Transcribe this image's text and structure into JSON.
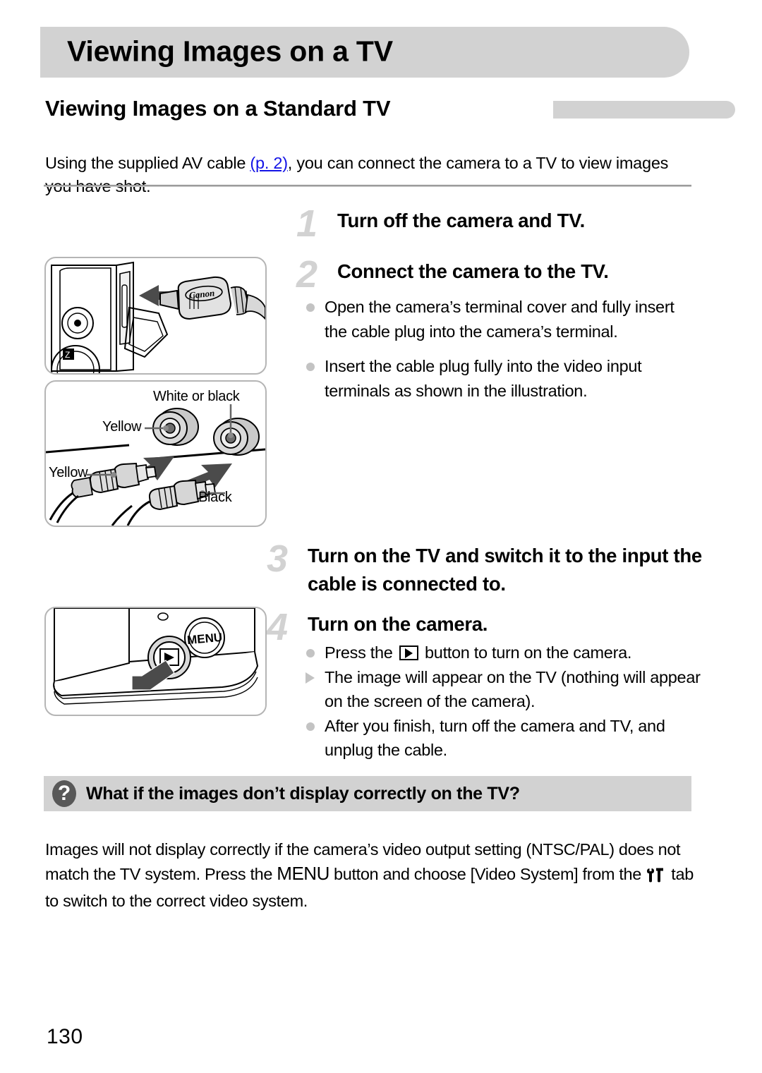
{
  "chapter": {
    "title": "Viewing Images on a TV"
  },
  "section": {
    "title": "Viewing Images on a Standard TV"
  },
  "intro": {
    "before_link": "Using the supplied AV cable ",
    "link": "(p. 2)",
    "after_link": ", you can connect the camera to a TV to view images you have shot."
  },
  "steps": [
    {
      "number": "1",
      "title": "Turn off the camera and TV."
    },
    {
      "number": "2",
      "title": "Connect the camera to the TV.",
      "bullets": [
        {
          "marker": "dot",
          "text": "Open the camera’s terminal cover and fully insert the cable plug into the camera’s terminal."
        },
        {
          "marker": "dot",
          "text": "Insert the cable plug fully into the video input terminals as shown in the illustration."
        }
      ]
    },
    {
      "number": "3",
      "title": "Turn on the TV and switch it to the input the cable is connected to."
    },
    {
      "number": "4",
      "title": "Turn on the camera.",
      "bullets": [
        {
          "marker": "dot",
          "text_before_icon": "Press the ",
          "icon": "playback-button-icon",
          "text_after_icon": " button to turn on the camera."
        },
        {
          "marker": "triangle",
          "text": "The image will appear on the TV (nothing will appear on the screen of the camera)."
        },
        {
          "marker": "dot",
          "text": "After you finish, turn off the camera and TV, and unplug the cable."
        }
      ]
    }
  ],
  "illustrations": {
    "camera_terminal": {
      "name": "camera-terminal-cable-insert",
      "brand_text": "Canon"
    },
    "av_plugs": {
      "name": "av-cable-plug-connection",
      "labels": {
        "white_or_black": "White or black",
        "yellow_jack": "Yellow",
        "yellow_plug": "Yellow",
        "black_plug": "Black"
      }
    },
    "playback_button": {
      "name": "camera-playback-button-press",
      "menu_text": "MENU"
    }
  },
  "faq": {
    "question": "What if the images don’t display correctly on the TV?",
    "icon": "question-mark-icon",
    "answer_part1": "Images will not display correctly if the camera’s video output setting (NTSC/PAL) does not match the TV system. Press the ",
    "menu_label": "MENU",
    "answer_part2": " button and choose [Video System] from the ",
    "tab_icon": "settings-tab-icon",
    "answer_part3": " tab to switch to the correct video system."
  },
  "page": {
    "number": "130"
  },
  "colors": {
    "accent_gray": "#d2d2d2",
    "link_blue": "#1414e6",
    "step_number_gray": "#d2d2d2",
    "bullet_gray": "#c3c3c3",
    "faq_icon_gray": "#585858"
  }
}
